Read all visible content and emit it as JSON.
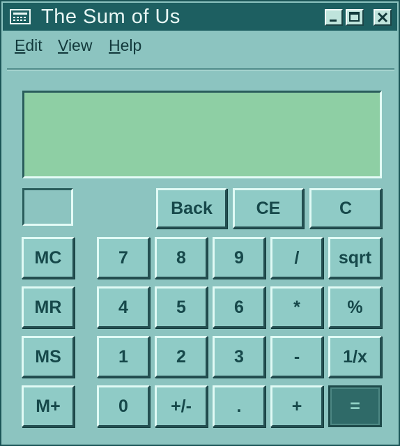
{
  "window": {
    "title": "The Sum of Us"
  },
  "menu": [
    {
      "label": "Edit",
      "mnemonic": "E",
      "rest": "dit"
    },
    {
      "label": "View",
      "mnemonic": "V",
      "rest": "iew"
    },
    {
      "label": "Help",
      "mnemonic": "H",
      "rest": "elp"
    }
  ],
  "display": {
    "value": ""
  },
  "memory_indicator": "",
  "keys": {
    "back": "Back",
    "ce": "CE",
    "c": "C",
    "mc": "MC",
    "mr": "MR",
    "ms": "MS",
    "mplus": "M+",
    "k7": "7",
    "k8": "8",
    "k9": "9",
    "div": "/",
    "sqrt": "sqrt",
    "k4": "4",
    "k5": "5",
    "k6": "6",
    "mul": "*",
    "pct": "%",
    "k1": "1",
    "k2": "2",
    "k3": "3",
    "sub": "-",
    "recip": "1/x",
    "k0": "0",
    "sign": "+/-",
    "dot": ".",
    "add": "+",
    "eq": "="
  },
  "colors": {
    "titlebar": "#1d5f61",
    "body": "#8cc4c0",
    "display": "#8ecfa4"
  }
}
